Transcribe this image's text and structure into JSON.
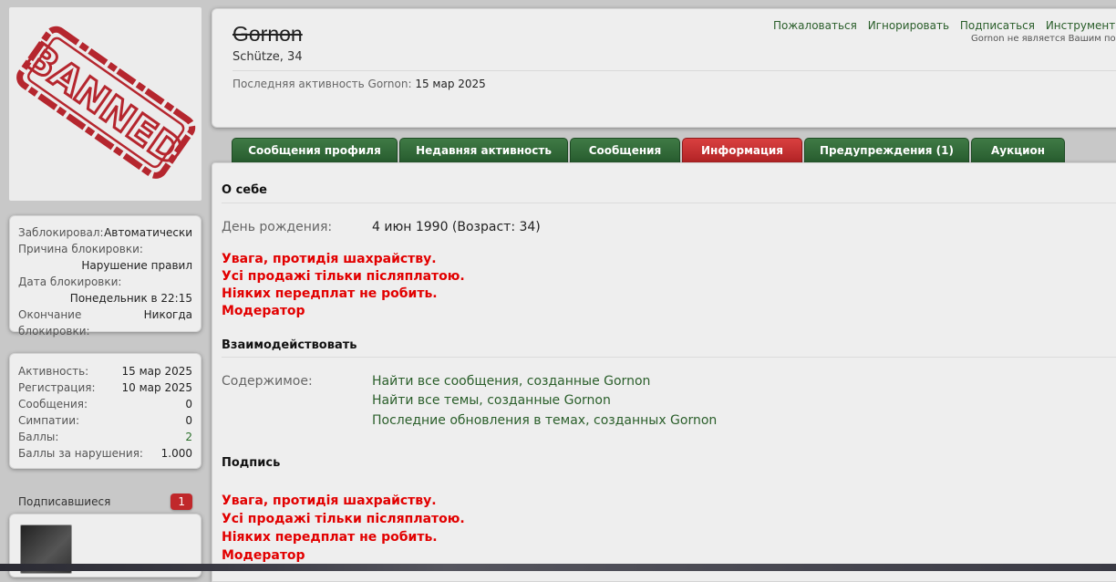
{
  "avatar": {
    "stamp_text": "BANNED"
  },
  "ban_info": {
    "blocked_by_label": "Заблокировал:",
    "blocked_by_value": "Автоматически",
    "reason_label": "Причина блокировки:",
    "reason_value": "Нарушение правил",
    "date_label": "Дата блокировки:",
    "date_value": "Понедельник в 22:15",
    "end_label": "Окончание блокировки:",
    "end_value": "Никогда"
  },
  "stats": [
    {
      "label": "Активность:",
      "value": "15 мар 2025"
    },
    {
      "label": "Регистрация:",
      "value": "10 мар 2025"
    },
    {
      "label": "Сообщения:",
      "value": "0"
    },
    {
      "label": "Симпатии:",
      "value": "0"
    },
    {
      "label": "Баллы:",
      "value": "2"
    },
    {
      "label": "Баллы за нарушения:",
      "value": "1.000"
    }
  ],
  "followers": {
    "label": "Подписавшиеся",
    "count": "1"
  },
  "header": {
    "username": "Gornon",
    "user_title": "Schütze, 34",
    "last_activity_label": "Последняя активность Gornon:",
    "last_activity_value": "15 мар 2025",
    "actions": [
      "Пожаловаться",
      "Игнорировать",
      "Подписаться",
      "Инструменты модера"
    ],
    "not_following": "Gornon не является Вашим под"
  },
  "tabs": [
    {
      "label": "Сообщения профиля"
    },
    {
      "label": "Недавняя активность"
    },
    {
      "label": "Сообщения"
    },
    {
      "label": "Информация"
    },
    {
      "label": "Предупреждения (1)"
    },
    {
      "label": "Аукцион"
    }
  ],
  "about": {
    "heading": "О себе",
    "birthday_label": "День рождения:",
    "birthday_value": "4 июн 1990 (Возраст: 34)",
    "warning_lines": [
      "Увага, протидія шахрайству.",
      "Усі продажі тільки післяплатою.",
      "Ніяких передплат не робить.",
      "Модератор"
    ]
  },
  "interact": {
    "heading": "Взаимодействовать",
    "content_label": "Содержимое:",
    "links": [
      "Найти все сообщения, созданные Gornon",
      "Найти все темы, созданные Gornon",
      "Последние обновления в темах, созданных Gornon"
    ]
  },
  "signature": {
    "heading": "Подпись",
    "lines": [
      "Увага, протидія шахрайству.",
      "Усі продажі тільки післяплатою.",
      "Ніяких передплат не робить.",
      "Модератор"
    ]
  },
  "colors": {
    "accent_green": "#2a5e2a",
    "tab_green": "#2f6b36",
    "tab_active_red": "#c0282b",
    "warning_red": "#e20000"
  }
}
